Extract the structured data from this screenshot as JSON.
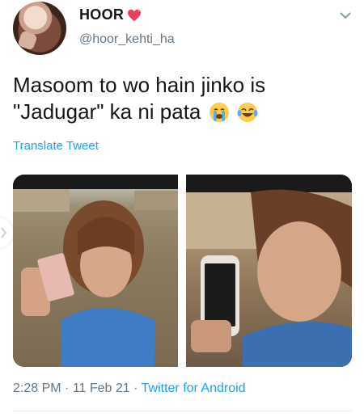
{
  "tweet": {
    "author_name": "HOOR",
    "author_handle": "@hoor_kehti_ha",
    "text": "Masoom to wo hain jinko is \"Jadugar\" ka ni pata",
    "translate_label": "Translate Tweet",
    "time": "2:28 PM",
    "separator1": " · ",
    "date": "11 Feb 21",
    "separator2": " · ",
    "source_app": "Twitter for Android"
  },
  "icons": {
    "name_badge": "sparkling-heart-icon",
    "emoji_1": "crying-face-icon",
    "emoji_2": "laughing-tears-icon",
    "menu": "chevron-down-icon"
  },
  "colors": {
    "link": "#1da1f2",
    "secondary_text": "#657786",
    "primary_text": "#14171a"
  }
}
